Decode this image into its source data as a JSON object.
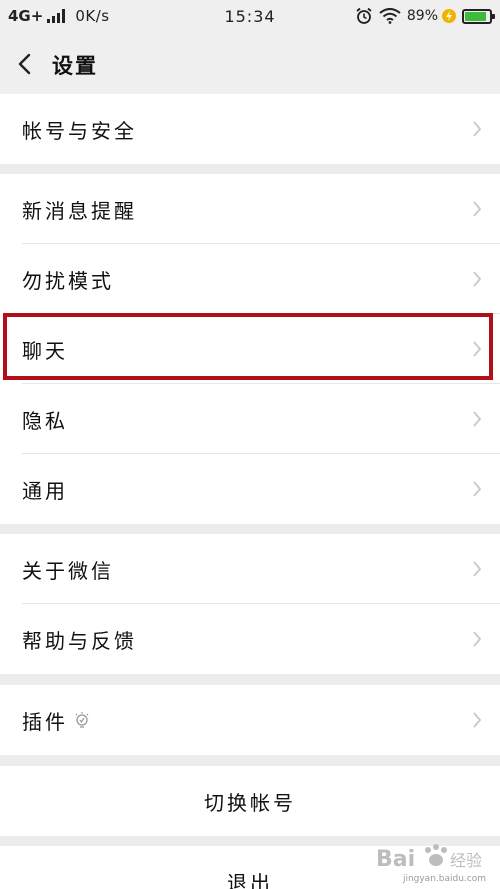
{
  "status": {
    "network": "4G+",
    "speed": "0K/s",
    "time": "15:34",
    "battery": "89%",
    "battery_level": 0.89,
    "icons": [
      "signal-bars-icon",
      "alarm-icon",
      "wifi-icon",
      "charging-icon",
      "battery-icon"
    ]
  },
  "header": {
    "title": "设置",
    "back_icon": "chevron-left-icon"
  },
  "groups": {
    "account": {
      "items": [
        {
          "label": "帐号与安全"
        }
      ]
    },
    "general": {
      "items": [
        {
          "label": "新消息提醒"
        },
        {
          "label": "勿扰模式"
        },
        {
          "label": "聊天"
        },
        {
          "label": "隐私"
        },
        {
          "label": "通用"
        }
      ]
    },
    "about": {
      "items": [
        {
          "label": "关于微信"
        },
        {
          "label": "帮助与反馈"
        }
      ]
    },
    "plugins": {
      "items": [
        {
          "label": "插件",
          "icon": "lightbulb-icon"
        }
      ]
    }
  },
  "actions": {
    "switch_account": "切换帐号",
    "logout": "退出"
  },
  "colors": {
    "highlight": "#b30f17",
    "battery": "#3dbb3d",
    "background": "#ececec"
  },
  "watermark": {
    "brand": "Bai",
    "brand_cn": "经验",
    "url": "jingyan.baidu.com"
  }
}
